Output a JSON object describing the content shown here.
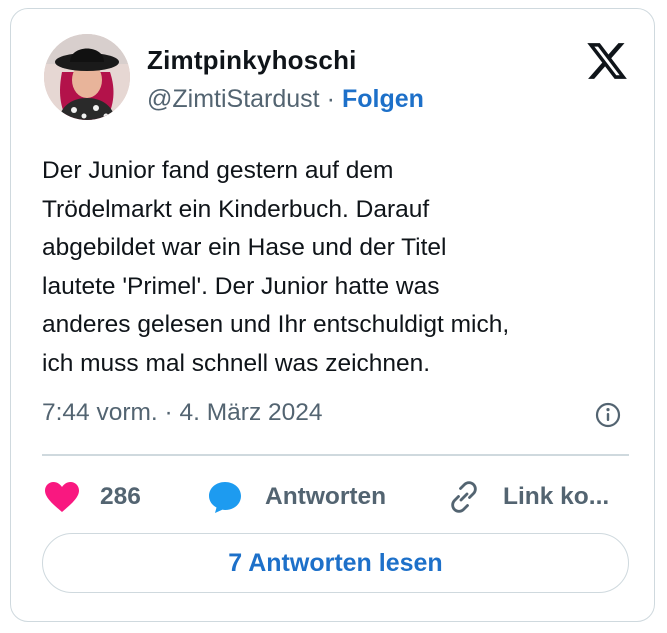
{
  "tweet": {
    "author": {
      "display_name": "Zimtpinkyhoschi",
      "handle": "@ZimtiStardust",
      "separator": "·",
      "follow_label": "Folgen",
      "avatar_icon": "user-avatar-photo"
    },
    "platform_icon": "x-logo-icon",
    "text": "Der Junior fand gestern auf dem\nTrödelmarkt ein Kinderbuch. Darauf\nabgebildet war ein Hase und der Titel\nlautete 'Primel'. Der Junior hatte was\nanderes gelesen und Ihr entschuldigt mich,\nich muss mal schnell was zeichnen.",
    "timestamp": "7:44 vorm. · 4. März 2024",
    "info_icon": "info-circle-icon",
    "actions": {
      "like": {
        "icon": "heart-icon",
        "count": "286",
        "color": "#f91880"
      },
      "reply": {
        "icon": "speech-bubble-icon",
        "label": "Antworten",
        "color": "#1d9bf0"
      },
      "copy_link": {
        "icon": "link-icon",
        "label": "Link ko..."
      }
    },
    "read_replies_label": "7 Antworten lesen"
  },
  "colors": {
    "text_primary": "#0f1419",
    "text_secondary": "#536471",
    "link_blue": "#1d70c9",
    "border": "#cfd9de"
  }
}
